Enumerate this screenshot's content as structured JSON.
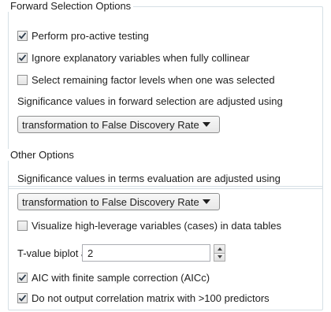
{
  "forward_selection": {
    "title": "Forward Selection Options",
    "pro_active_testing": {
      "label": "Perform pro-active testing",
      "checked": true
    },
    "ignore_collinear": {
      "label": "Ignore explanatory variables when fully collinear",
      "checked": true
    },
    "select_remaining_levels": {
      "label": "Select remaining factor levels when one was selected",
      "checked": false
    },
    "adjustment_caption": "Significance values in forward selection are adjusted using",
    "adjustment_method": "transformation to False Discovery Rate"
  },
  "other_options": {
    "title": "Other Options",
    "terms_adjustment_caption": "Significance values in terms evaluation are adjusted using",
    "terms_adjustment_method": "transformation to False Discovery Rate",
    "visualize_high_leverage": {
      "label": "Visualize high-leverage variables (cases) in data tables",
      "checked": false
    },
    "tvalue_label": "T-value biplot axes:",
    "tvalue_value": "2",
    "aicc": {
      "label": "AIC with finite sample correction (AICc)",
      "checked": true
    },
    "no_correlation_matrix": {
      "label": "Do not output correlation matrix with >100 predictors",
      "checked": true
    }
  },
  "colors": {
    "group_border": "#d5dfe5",
    "checkmark": "#2b3a4a"
  }
}
